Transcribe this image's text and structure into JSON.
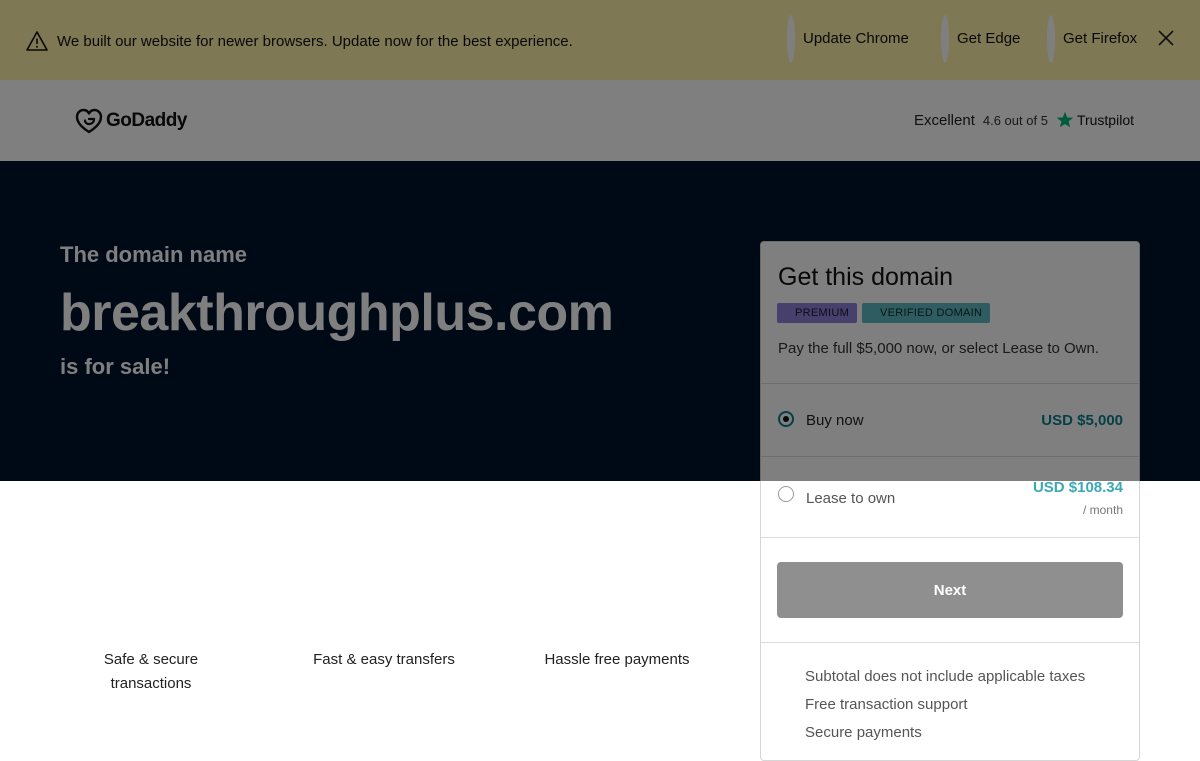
{
  "banner": {
    "message": "We built our website for newer browsers. Update now for the best experience.",
    "links": [
      "Update Chrome",
      "Get Edge",
      "Get Firefox"
    ],
    "icons": {
      "warning": "warning-triangle-icon",
      "close": "close-icon"
    }
  },
  "header": {
    "logo_text": "GoDaddy",
    "rating": {
      "label": "Excellent",
      "score": "4.6 out of 5",
      "provider": "Trustpilot"
    }
  },
  "hero": {
    "line1": "The domain name",
    "domain": "breakthroughplus.com",
    "line3": "is for sale!"
  },
  "features": [
    "Safe & secure transactions",
    "Fast & easy transfers",
    "Hassle free payments"
  ],
  "card": {
    "title": "Get this domain",
    "badges": [
      "PREMIUM",
      "VERIFIED DOMAIN"
    ],
    "description": "Pay the full $5,000 now, or select Lease to Own.",
    "options": [
      {
        "label": "Buy now",
        "price": "USD $5,000",
        "selected": true
      },
      {
        "label": "Lease to own",
        "price": "USD $108.34",
        "sub": "/ month",
        "selected": false
      }
    ],
    "next_label": "Next",
    "info": [
      "Subtotal does not include applicable taxes",
      "Free transaction support",
      "Secure payments"
    ]
  },
  "colors": {
    "banner_bg": "#fdf0a8",
    "hero_bg": "#00132d",
    "accent_teal": "#0a7f8c",
    "trustpilot_green": "#00b67a"
  }
}
